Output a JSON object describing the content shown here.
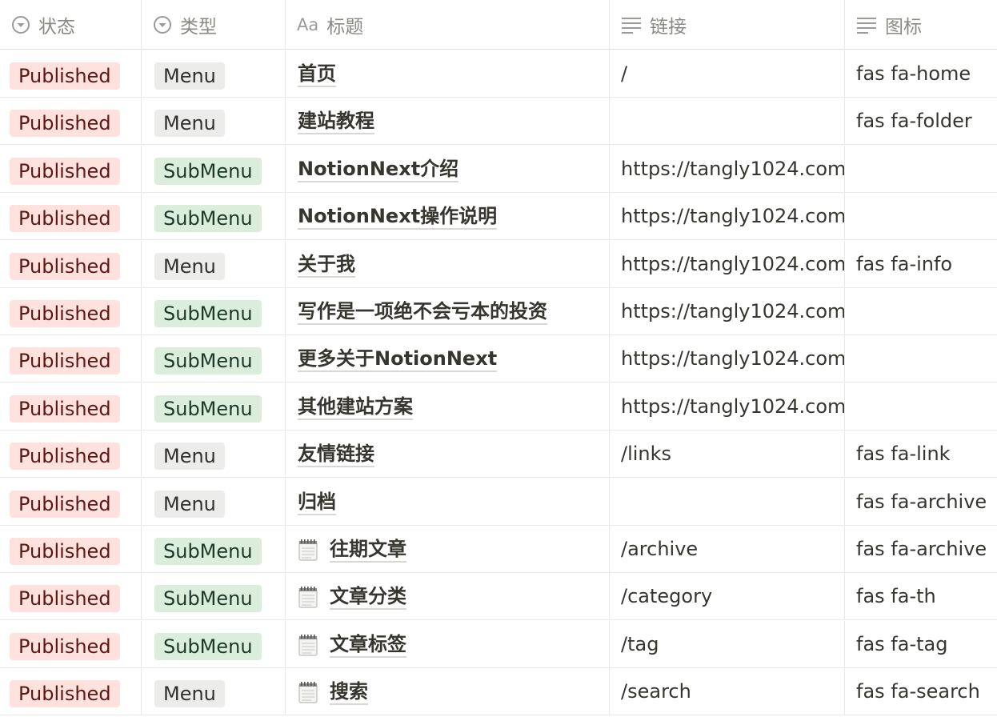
{
  "columns": [
    {
      "label": "状态",
      "icon": "select-icon"
    },
    {
      "label": "类型",
      "icon": "select-icon"
    },
    {
      "label": "标题",
      "icon": "title-aa-icon",
      "prefix": "Aa"
    },
    {
      "label": "链接",
      "icon": "text-lines-icon"
    },
    {
      "label": "图标",
      "icon": "text-lines-icon"
    }
  ],
  "rows": [
    {
      "status": "Published",
      "type": "Menu",
      "title": "首页",
      "link": "/",
      "icon": "fas fa-home",
      "emoji": false
    },
    {
      "status": "Published",
      "type": "Menu",
      "title": "建站教程",
      "link": "",
      "icon": "fas fa-folder",
      "emoji": false
    },
    {
      "status": "Published",
      "type": "SubMenu",
      "title": "NotionNext介绍",
      "link": "https://tangly1024.com/",
      "icon": "",
      "emoji": false
    },
    {
      "status": "Published",
      "type": "SubMenu",
      "title": "NotionNext操作说明",
      "link": "https://tangly1024.com/",
      "icon": "",
      "emoji": false
    },
    {
      "status": "Published",
      "type": "Menu",
      "title": "关于我",
      "link": "https://tangly1024.com/",
      "icon": "fas fa-info",
      "emoji": false
    },
    {
      "status": "Published",
      "type": "SubMenu",
      "title": "写作是一项绝不会亏本的投资",
      "link": "https://tangly1024.com/",
      "icon": "",
      "emoji": false
    },
    {
      "status": "Published",
      "type": "SubMenu",
      "title": "更多关于NotionNext",
      "link": "https://tangly1024.com/",
      "icon": "",
      "emoji": false
    },
    {
      "status": "Published",
      "type": "SubMenu",
      "title": "其他建站方案",
      "link": "https://tangly1024.com/",
      "icon": "",
      "emoji": false
    },
    {
      "status": "Published",
      "type": "Menu",
      "title": "友情链接",
      "link": "/links",
      "icon": "fas fa-link",
      "emoji": false
    },
    {
      "status": "Published",
      "type": "Menu",
      "title": "归档",
      "link": "",
      "icon": "fas fa-archive",
      "emoji": false
    },
    {
      "status": "Published",
      "type": "SubMenu",
      "title": "往期文章",
      "link": "/archive",
      "icon": "fas fa-archive",
      "emoji": true
    },
    {
      "status": "Published",
      "type": "SubMenu",
      "title": "文章分类",
      "link": "/category",
      "icon": "fas fa-th",
      "emoji": true
    },
    {
      "status": "Published",
      "type": "SubMenu",
      "title": "文章标签",
      "link": "/tag",
      "icon": "fas fa-tag",
      "emoji": true
    },
    {
      "status": "Published",
      "type": "Menu",
      "title": "搜索",
      "link": "/search",
      "icon": "fas fa-search",
      "emoji": true
    }
  ],
  "colors": {
    "published_bg": "#ffe2dd",
    "menu_bg": "#ececeb",
    "submenu_bg": "#dbeddb"
  }
}
